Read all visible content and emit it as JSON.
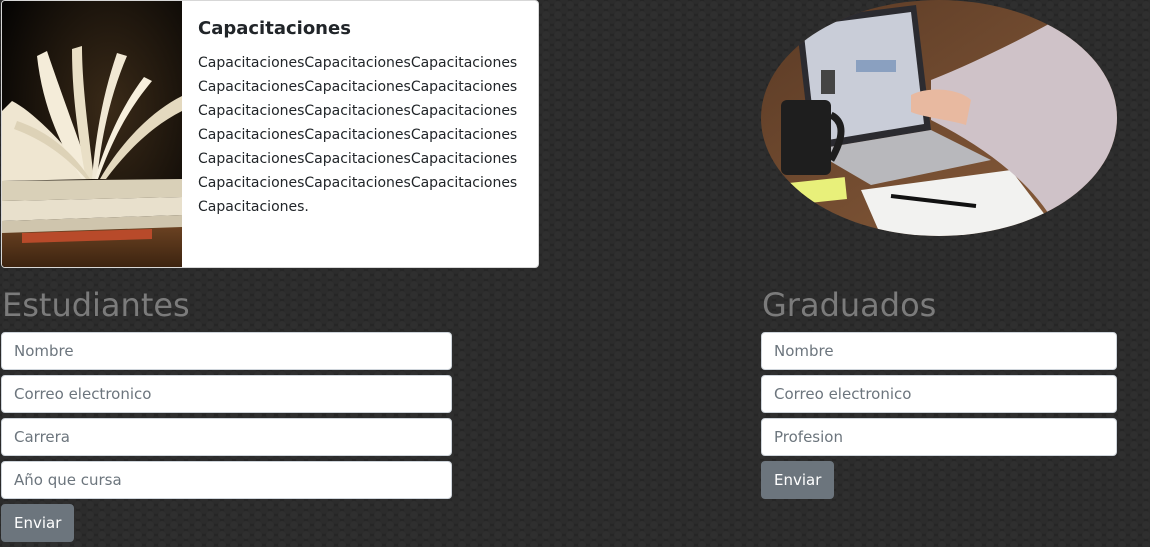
{
  "card": {
    "title": "Capacitaciones",
    "text": "CapacitacionesCapacitacionesCapacitacionesCapacitacionesCapacitacionesCapacitacionesCapacitacionesCapacitacionesCapacitacionesCapacitacionesCapacitacionesCapacitacionesCapacitacionesCapacitacionesCapacitacionesCapacitacionesCapacitacionesCapacitacionesCapacitaciones."
  },
  "students": {
    "heading": "Estudiantes",
    "fields": {
      "name_placeholder": "Nombre",
      "email_placeholder": "Correo electronico",
      "career_placeholder": "Carrera",
      "year_placeholder": "Año que cursa"
    },
    "submit_label": "Enviar"
  },
  "graduates": {
    "heading": "Graduados",
    "fields": {
      "name_placeholder": "Nombre",
      "email_placeholder": "Correo electronico",
      "profession_placeholder": "Profesion"
    },
    "submit_label": "Enviar"
  },
  "colors": {
    "background": "#252525",
    "heading": "#7b7b7b",
    "button": "#6c757d",
    "card": "#ffffff"
  }
}
